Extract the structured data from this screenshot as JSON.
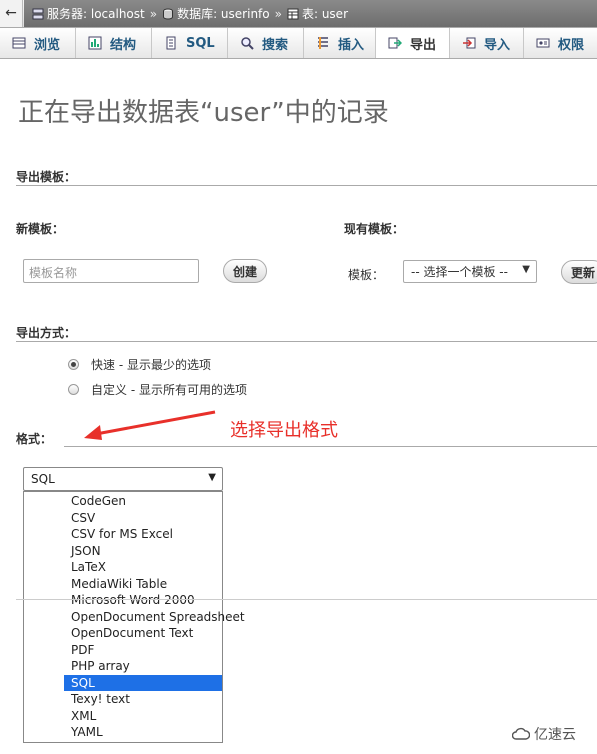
{
  "breadcrumb": {
    "back": "←",
    "server": "服务器: localhost",
    "separator": "»",
    "database": "数据库: userinfo",
    "table": "表: user"
  },
  "tabs": [
    {
      "label": "浏览",
      "icon": "browse-icon"
    },
    {
      "label": "结构",
      "icon": "structure-icon"
    },
    {
      "label": "SQL",
      "icon": "sql-icon"
    },
    {
      "label": "搜索",
      "icon": "search-icon"
    },
    {
      "label": "插入",
      "icon": "insert-icon"
    },
    {
      "label": "导出",
      "icon": "export-icon",
      "active": true
    },
    {
      "label": "导入",
      "icon": "import-icon"
    },
    {
      "label": "权限",
      "icon": "privileges-icon"
    }
  ],
  "page_title": "正在导出数据表“user”中的记录",
  "export_template": {
    "heading": "导出模板：",
    "new_template_label": "新模板：",
    "name_placeholder": "模板名称",
    "create_button": "创建",
    "existing_label": "现有模板：",
    "template_field_label": "模板：",
    "template_select_value": "-- 选择一个模板 --",
    "update_button": "更新"
  },
  "export_method": {
    "heading": "导出方式：",
    "options": [
      {
        "label": "快速 - 显示最少的选项",
        "checked": true
      },
      {
        "label": "自定义 - 显示所有可用的选项",
        "checked": false
      }
    ]
  },
  "format": {
    "heading": "格式：",
    "selected": "SQL",
    "options": [
      "CodeGen",
      "CSV",
      "CSV for MS Excel",
      "JSON",
      "LaTeX",
      "MediaWiki Table",
      "Microsoft Word 2000",
      "OpenDocument Spreadsheet",
      "OpenDocument Text",
      "PDF",
      "PHP array",
      "SQL",
      "Texy! text",
      "XML",
      "YAML"
    ]
  },
  "annotation": "选择导出格式",
  "watermark": "亿速云",
  "colors": {
    "accent": "#235a81",
    "annotation": "#e8302a",
    "selected_option": "#1e70e6"
  }
}
